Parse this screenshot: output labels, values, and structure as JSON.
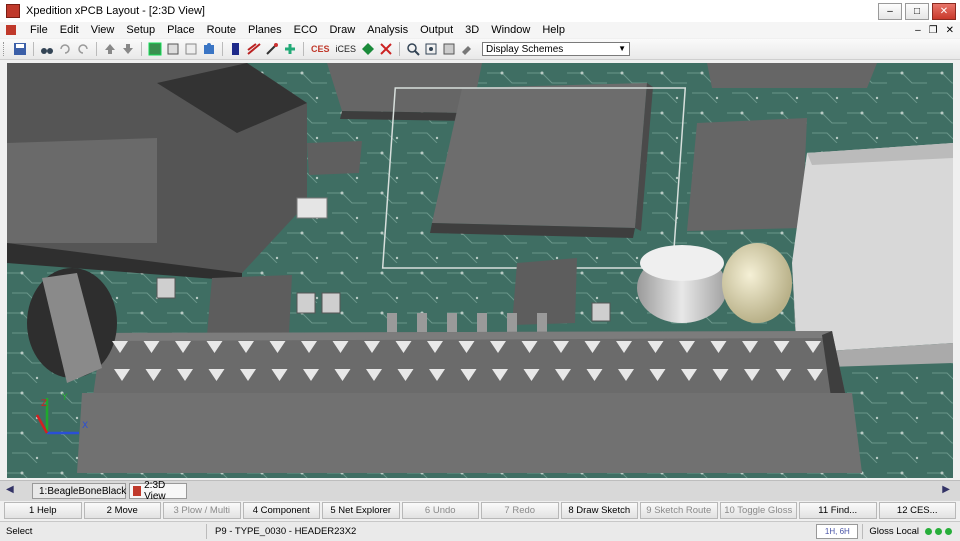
{
  "window": {
    "title": "Xpedition xPCB Layout   - [2:3D View]"
  },
  "menu": {
    "items": [
      "File",
      "Edit",
      "View",
      "Setup",
      "Place",
      "Route",
      "Planes",
      "ECO",
      "Draw",
      "Analysis",
      "Output",
      "3D",
      "Window",
      "Help"
    ]
  },
  "toolbar": {
    "ces_label": "CES",
    "ices_label": "iCES",
    "display_scheme_value": "Display Schemes"
  },
  "tabs": {
    "items": [
      "1:BeagleBoneBlack",
      "2:3D View"
    ],
    "active": 1
  },
  "function_keys": [
    {
      "label": "1 Help",
      "enabled": true
    },
    {
      "label": "2 Move",
      "enabled": true
    },
    {
      "label": "3 Plow / Multi",
      "enabled": false
    },
    {
      "label": "4 Component",
      "enabled": true
    },
    {
      "label": "5 Net Explorer",
      "enabled": true
    },
    {
      "label": "6 Undo",
      "enabled": false
    },
    {
      "label": "7 Redo",
      "enabled": false
    },
    {
      "label": "8 Draw Sketch",
      "enabled": true
    },
    {
      "label": "9 Sketch Route",
      "enabled": false
    },
    {
      "label": "10 Toggle Gloss",
      "enabled": false
    },
    {
      "label": "11 Find...",
      "enabled": true
    },
    {
      "label": "12 CES...",
      "enabled": true
    }
  ],
  "status": {
    "mode": "Select",
    "message": "P9 - TYPE_0030 - HEADER23X2",
    "coords": "1H, 6H",
    "gloss": "Gloss Local"
  },
  "axis": {
    "x": "X",
    "y": "Y",
    "z": "Z"
  },
  "colors": {
    "pcb": "#3f6e63",
    "component": "#6b6b6b",
    "accent": "#c0392b"
  }
}
